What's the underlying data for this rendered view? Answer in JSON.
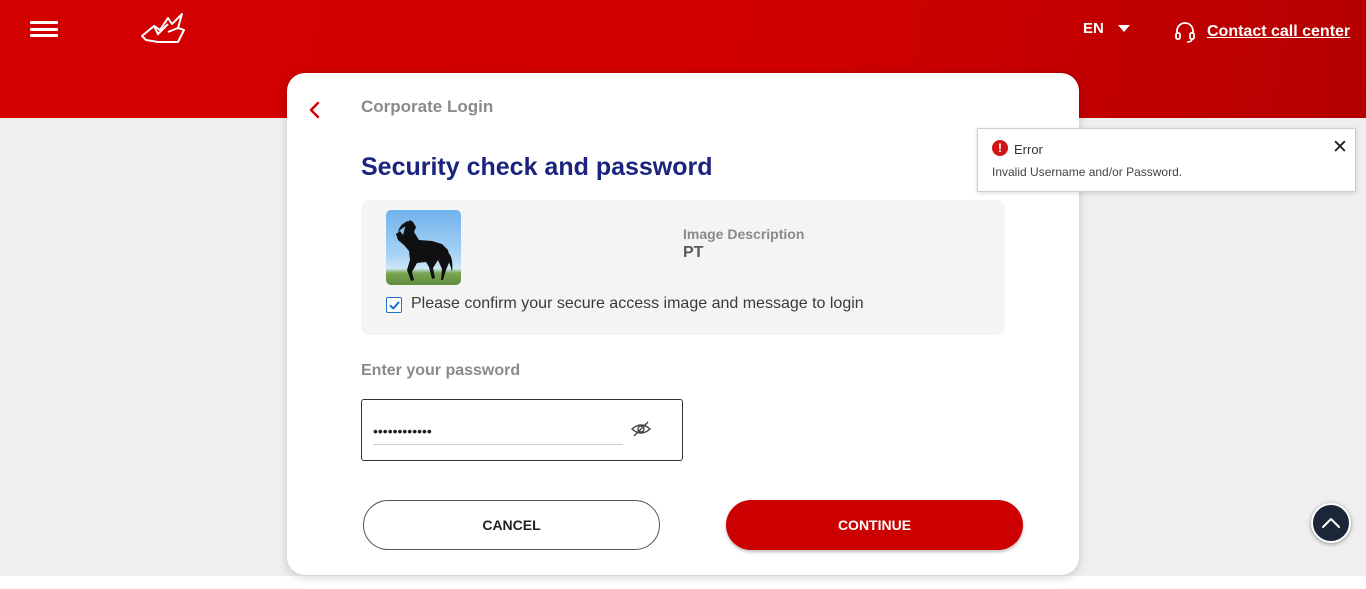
{
  "header": {
    "language": "EN",
    "contact_label": "Contact call center"
  },
  "card": {
    "breadcrumb": "Corporate Login",
    "title": "Security check and password",
    "security_image": {
      "description_label": "Image Description",
      "description_value": "PT",
      "confirm_label": "Please confirm your secure access image and message to login",
      "confirmed": true
    },
    "password": {
      "label": "Enter your password",
      "value": "••••••••••••"
    },
    "cancel_label": "CANCEL",
    "continue_label": "CONTINUE"
  },
  "toast": {
    "title": "Error",
    "message": "Invalid Username and/or Password."
  },
  "colors": {
    "brand_red": "#cc0000",
    "title_navy": "#1a237e",
    "error_red": "#d11515"
  },
  "icons": [
    "menu-icon",
    "logo",
    "caret-down-icon",
    "headset-icon",
    "chevron-left-icon",
    "horse-image",
    "checkbox-icon",
    "eye-off-icon",
    "error-icon",
    "close-icon",
    "chevron-up-icon"
  ]
}
